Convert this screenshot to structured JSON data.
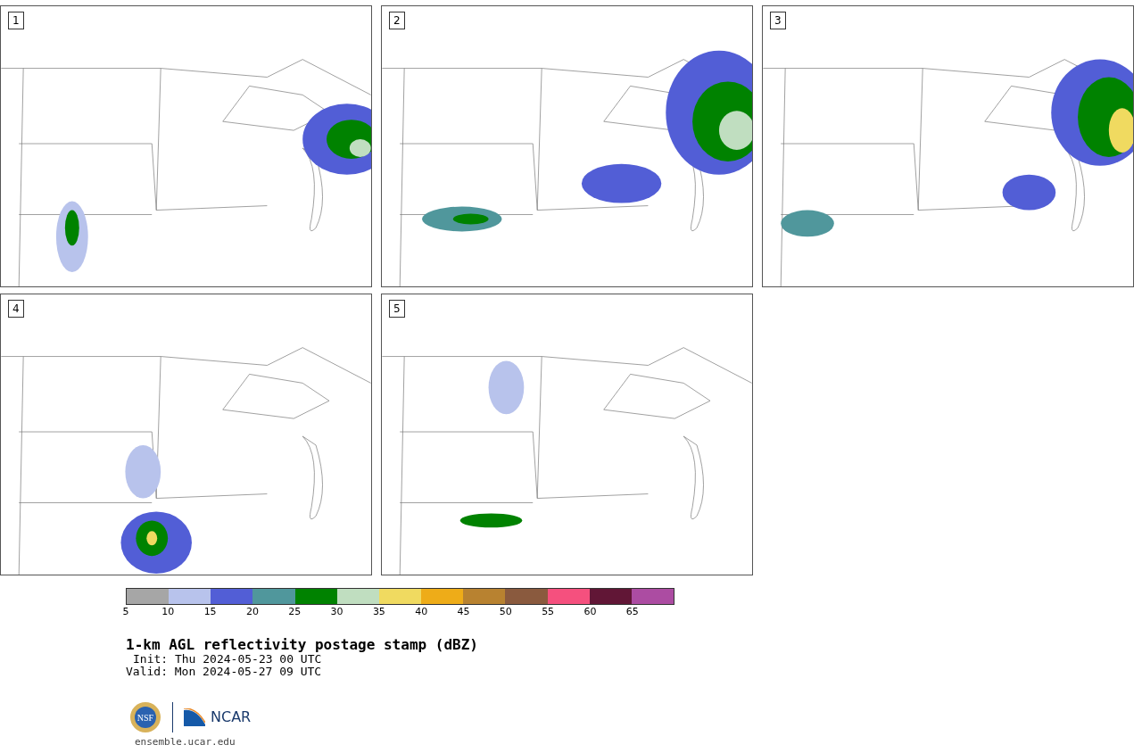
{
  "panels": [
    {
      "label": "1"
    },
    {
      "label": "2"
    },
    {
      "label": "3"
    },
    {
      "label": "4"
    },
    {
      "label": "5"
    }
  ],
  "colorbar": {
    "segments": [
      {
        "color": "#a6a6a6"
      },
      {
        "color": "#b8c3ec"
      },
      {
        "color": "#525ed6"
      },
      {
        "color": "#50979c"
      },
      {
        "color": "#008200"
      },
      {
        "color": "#c0dec0"
      },
      {
        "color": "#f0da60"
      },
      {
        "color": "#eeac18"
      },
      {
        "color": "#b88230"
      },
      {
        "color": "#8a5a3e"
      },
      {
        "color": "#f5507e"
      },
      {
        "color": "#611636"
      },
      {
        "color": "#ac4ca2"
      }
    ],
    "ticks": [
      "5",
      "10",
      "15",
      "20",
      "25",
      "30",
      "35",
      "40",
      "45",
      "50",
      "55",
      "60",
      "65"
    ]
  },
  "title": "1-km AGL reflectivity postage stamp (dBZ)",
  "init": "Init: Thu 2024-05-23 00 UTC",
  "valid": "Valid: Mon 2024-05-27 09 UTC",
  "logo": {
    "nsf": "NSF",
    "ncar": "NCAR"
  },
  "site": "ensemble.ucar.edu"
}
